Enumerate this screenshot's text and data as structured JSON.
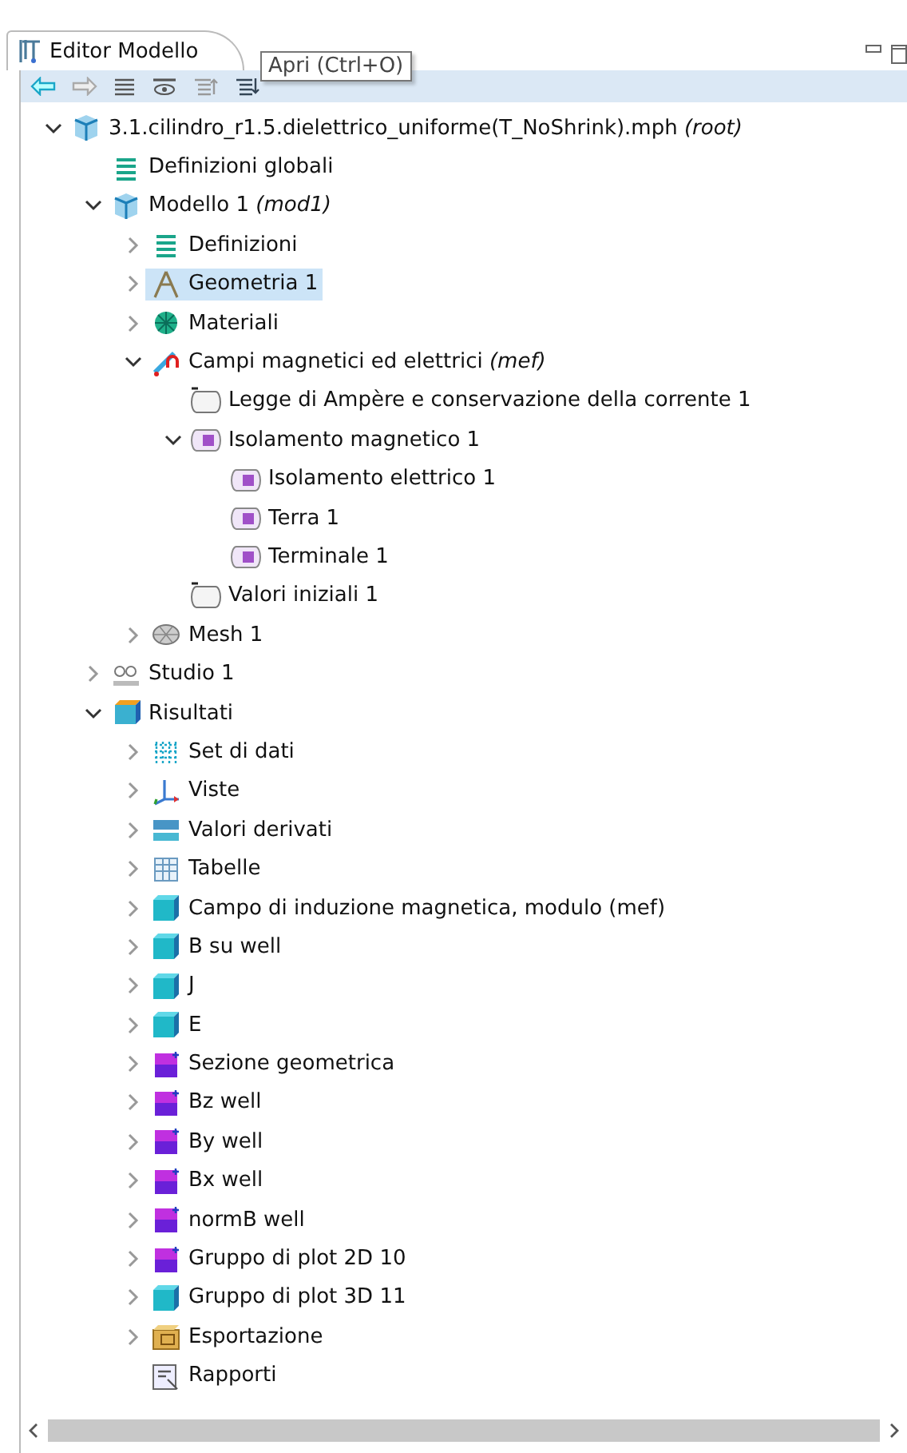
{
  "tab": {
    "title": "Editor Modello",
    "selected": true
  },
  "tooltip": "Apri (Ctrl+O)",
  "tree": [
    {
      "label": "3.1.cilindro_r1.5.dielettrico_uniforme(T_NoShrink).mph *(root)*",
      "kind": "file",
      "expanded": true,
      "selected": false,
      "children": [
        {
          "label": "Definizioni globali",
          "kind": "list",
          "selected": false
        },
        {
          "label": "Modello 1 *(mod1)*",
          "kind": "model",
          "expanded": true,
          "selected": false,
          "children": [
            {
              "label": "Definizioni",
              "kind": "list",
              "expanded": false,
              "selected": false
            },
            {
              "label": "Geometria 1",
              "kind": "geometry",
              "expanded": false,
              "selected": true
            },
            {
              "label": "Materiali",
              "kind": "materials",
              "expanded": false,
              "selected": false
            },
            {
              "label": "Campi magnetici ed elettrici *(mef)*",
              "kind": "physics",
              "expanded": true,
              "selected": false,
              "children": [
                {
                  "label": "Legge di Ampère e conservazione della corrente 1",
                  "kind": "domain",
                  "selected": false
                },
                {
                  "label": "Isolamento magnetico 1",
                  "kind": "boundary",
                  "expanded": true,
                  "selected": false,
                  "children": [
                    {
                      "label": "Isolamento elettrico 1",
                      "kind": "boundary",
                      "selected": false
                    },
                    {
                      "label": "Terra 1",
                      "kind": "boundary",
                      "selected": false
                    },
                    {
                      "label": "Terminale 1",
                      "kind": "boundary",
                      "selected": false
                    }
                  ]
                },
                {
                  "label": "Valori iniziali 1",
                  "kind": "domain",
                  "selected": false
                }
              ]
            },
            {
              "label": "Mesh 1",
              "kind": "mesh",
              "expanded": false,
              "selected": false
            }
          ]
        },
        {
          "label": "Studio 1",
          "kind": "study",
          "expanded": false,
          "selected": false
        },
        {
          "label": "Risultati",
          "kind": "results",
          "expanded": true,
          "selected": false,
          "children": [
            {
              "label": "Set di dati",
              "kind": "dataset",
              "expanded": false,
              "selected": false
            },
            {
              "label": "Viste",
              "kind": "axes",
              "expanded": false,
              "selected": false
            },
            {
              "label": "Valori derivati",
              "kind": "derived",
              "expanded": false,
              "selected": false
            },
            {
              "label": "Tabelle",
              "kind": "table",
              "expanded": false,
              "selected": false
            },
            {
              "label": "Campo di induzione magnetica, modulo (mef)",
              "kind": "plot3d",
              "expanded": false,
              "selected": false
            },
            {
              "label": "B su well",
              "kind": "plot3d",
              "expanded": false,
              "selected": false
            },
            {
              "label": "J",
              "kind": "plot3d",
              "expanded": false,
              "selected": false
            },
            {
              "label": "E",
              "kind": "plot3d",
              "expanded": false,
              "selected": false
            },
            {
              "label": "Sezione geometrica",
              "kind": "plot2d",
              "expanded": false,
              "selected": false
            },
            {
              "label": "Bz well",
              "kind": "plot2d",
              "expanded": false,
              "selected": false
            },
            {
              "label": "By well",
              "kind": "plot2d",
              "expanded": false,
              "selected": false
            },
            {
              "label": "Bx well",
              "kind": "plot2d",
              "expanded": false,
              "selected": false
            },
            {
              "label": "normB well",
              "kind": "plot2d",
              "expanded": false,
              "selected": false
            },
            {
              "label": "Gruppo di plot 2D 10",
              "kind": "plot2d",
              "expanded": false,
              "selected": false
            },
            {
              "label": "Gruppo di plot 3D 11",
              "kind": "plot3d",
              "expanded": false,
              "selected": false
            },
            {
              "label": "Esportazione",
              "kind": "export",
              "expanded": false,
              "selected": false
            },
            {
              "label": "Rapporti",
              "kind": "report",
              "selected": false
            }
          ]
        }
      ]
    }
  ]
}
